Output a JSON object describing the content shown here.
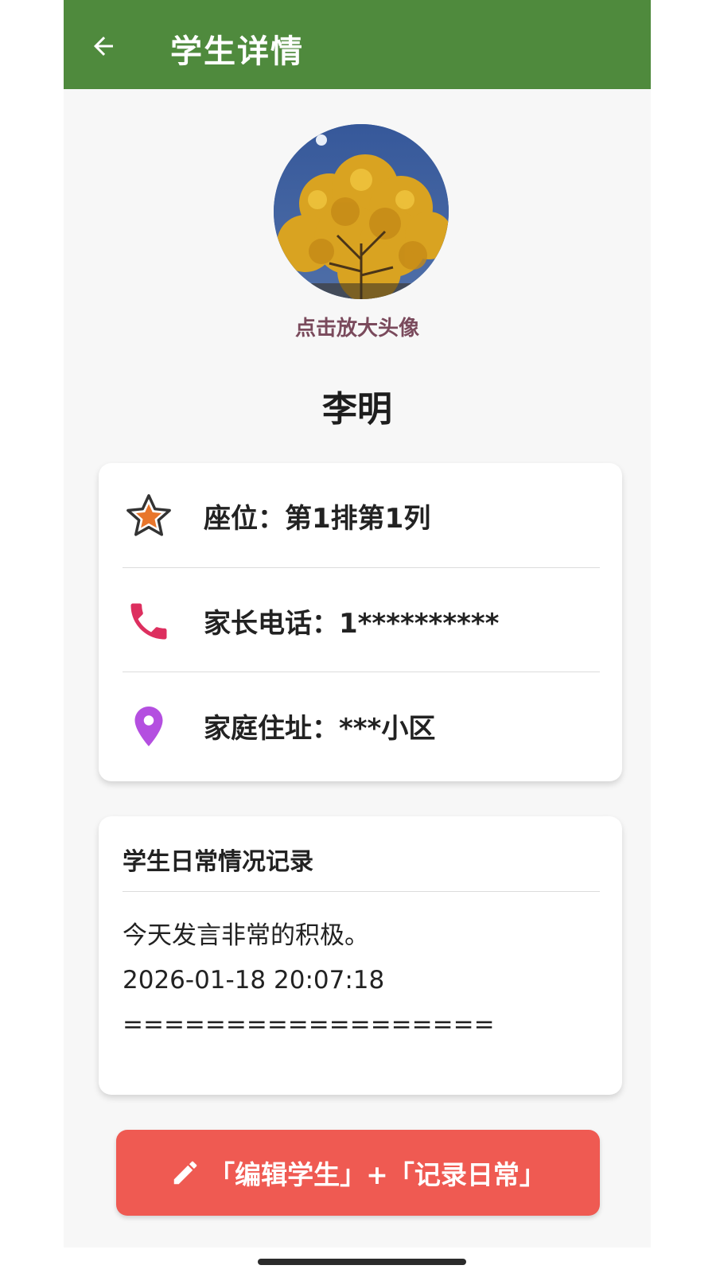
{
  "app_bar": {
    "title": "学生详情",
    "back_icon": "arrow-left-icon",
    "background_color": "#4f8a3d"
  },
  "profile": {
    "avatar_hint": "点击放大头像",
    "name": "李明"
  },
  "info": {
    "seat": "座位：第1排第1列",
    "seat_icon": "star-icon",
    "phone": "家长电话：1**********",
    "phone_icon": "phone-icon",
    "address": "家庭住址：***小区",
    "address_icon": "location-pin-icon"
  },
  "daily_log": {
    "title": "学生日常情况记录",
    "lines": [
      "今天发言非常的积极。",
      "2026-01-18 20:07:18",
      "=================="
    ]
  },
  "action_button": {
    "label": "「编辑学生」+「记录日常」",
    "icon": "pencil-icon",
    "color": "#ef5a52"
  }
}
